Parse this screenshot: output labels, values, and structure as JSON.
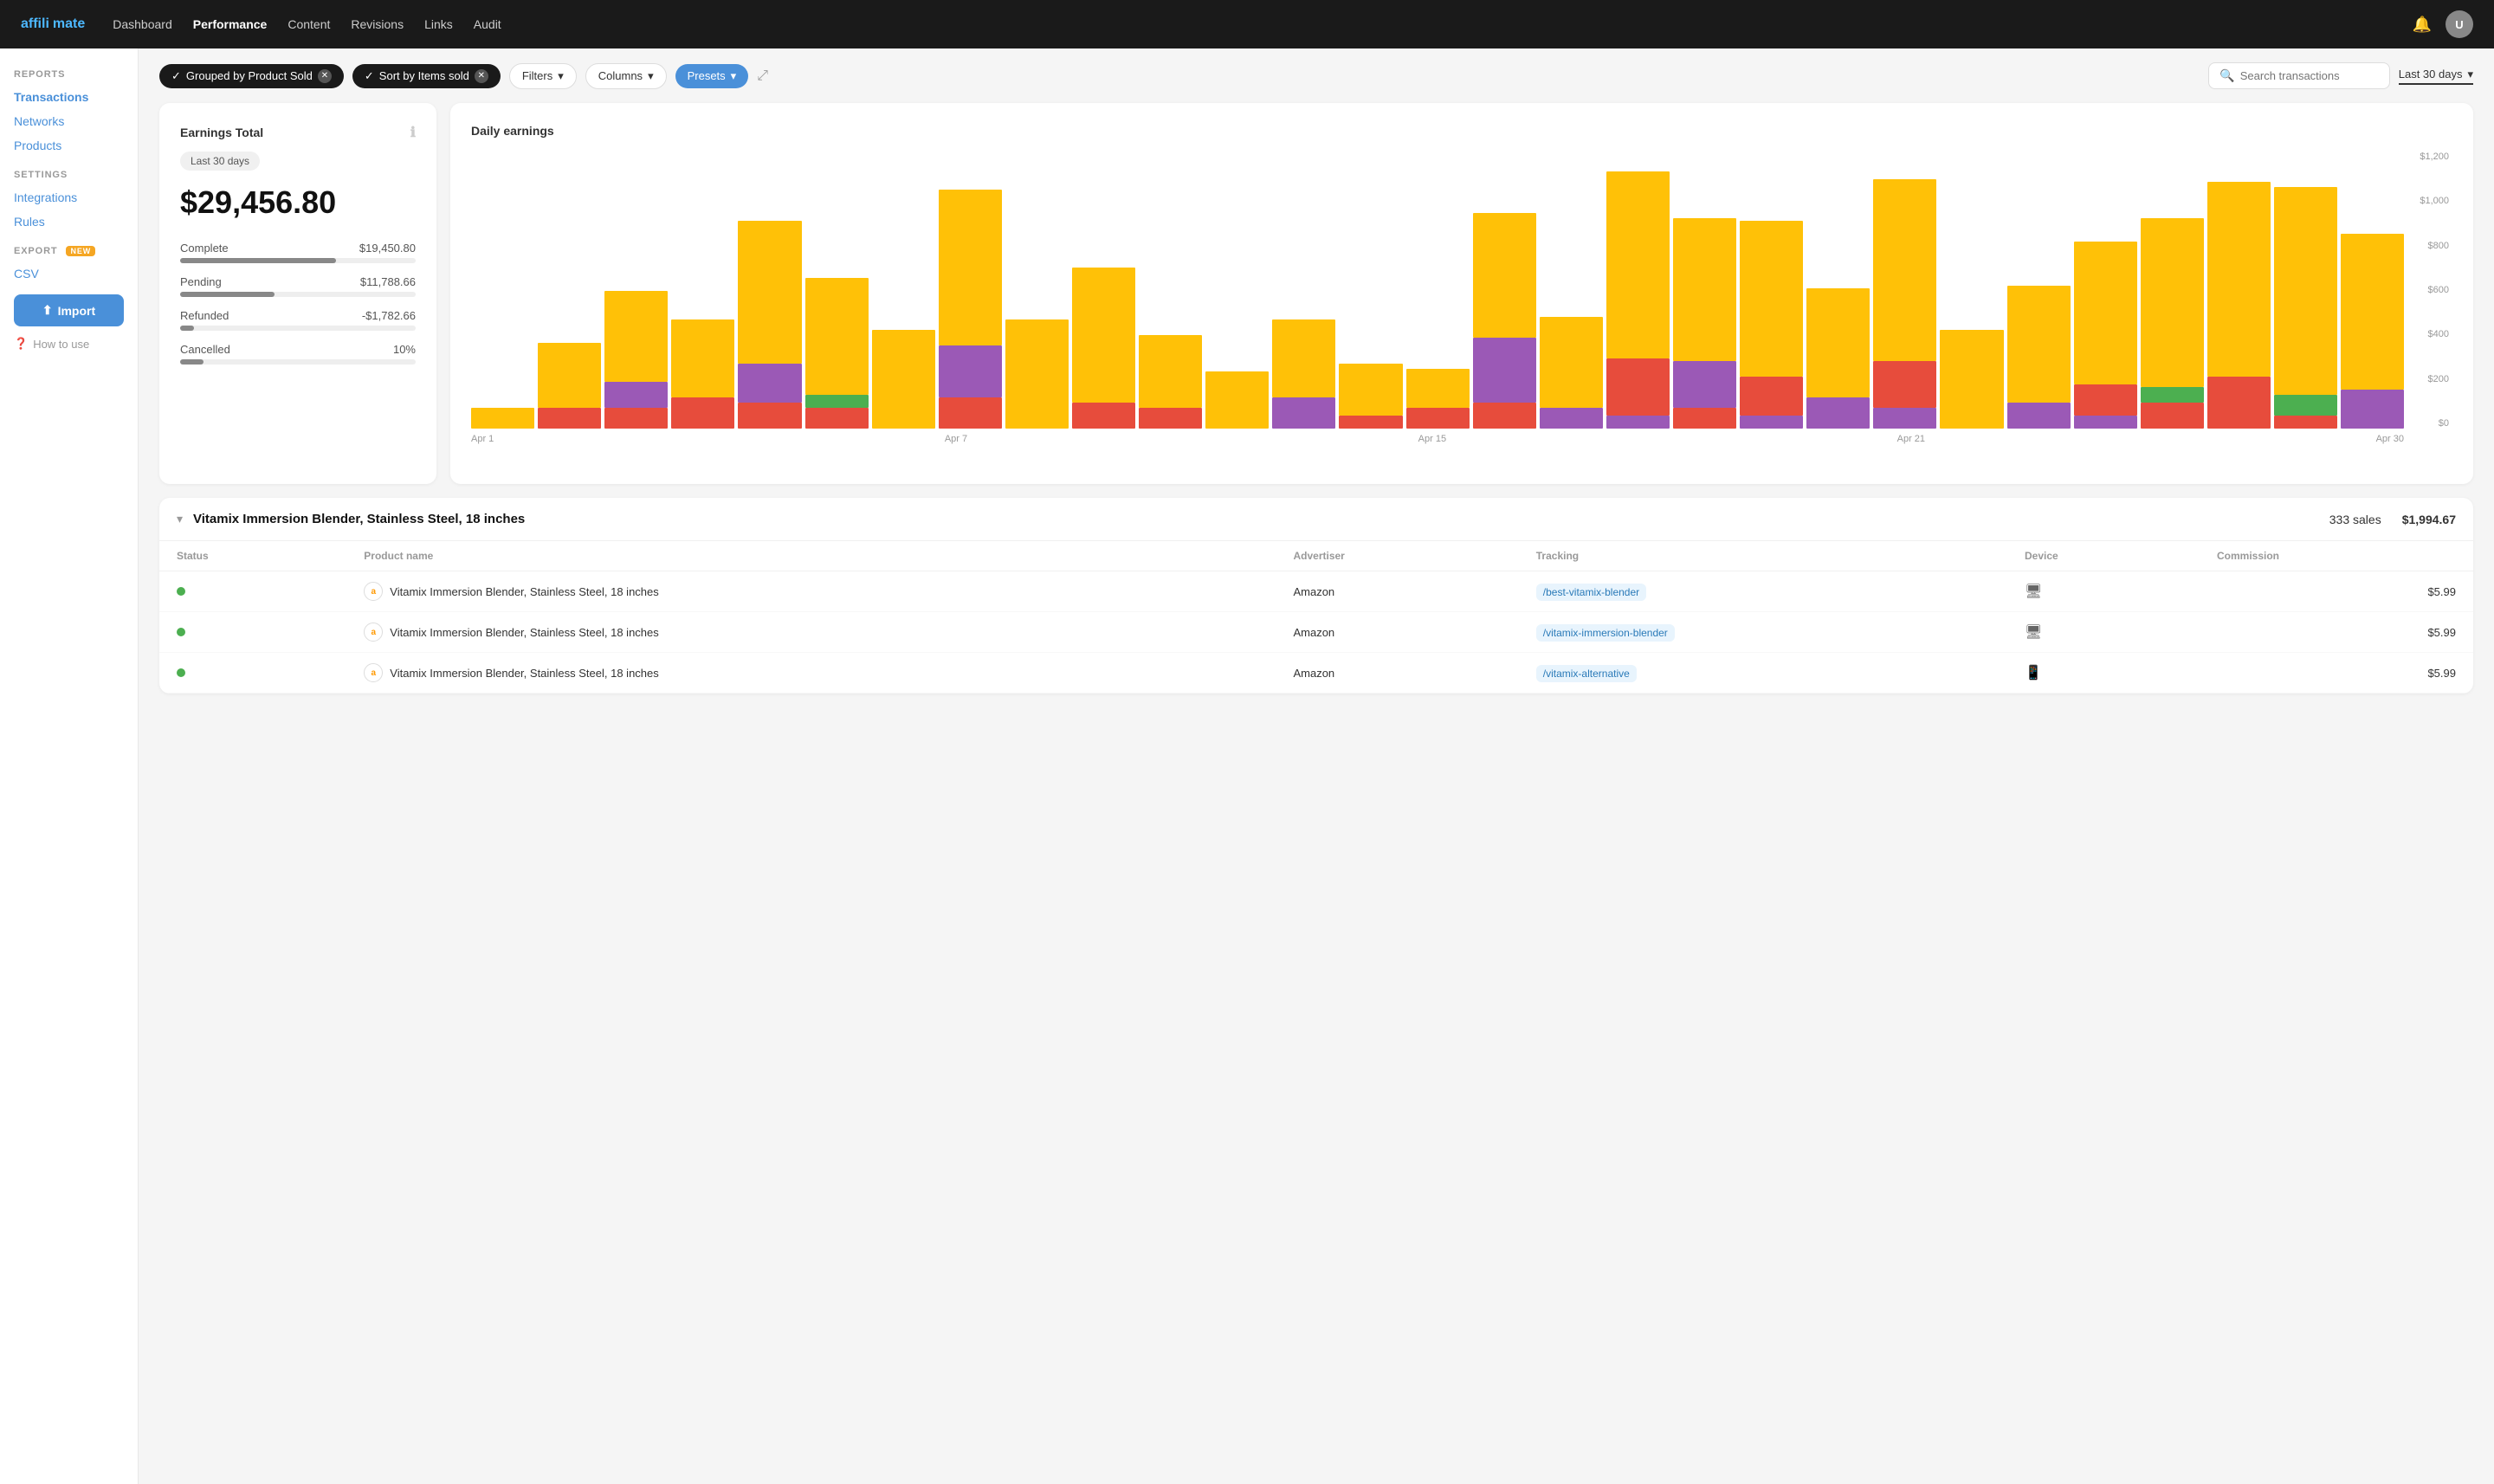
{
  "brand": {
    "name_part1": "affili",
    "name_part2": "mate"
  },
  "nav": {
    "links": [
      {
        "label": "Dashboard",
        "active": false
      },
      {
        "label": "Performance",
        "active": true
      },
      {
        "label": "Content",
        "active": false
      },
      {
        "label": "Revisions",
        "active": false
      },
      {
        "label": "Links",
        "active": false
      },
      {
        "label": "Audit",
        "active": false
      }
    ]
  },
  "sidebar": {
    "reports_label": "REPORTS",
    "reports_links": [
      {
        "label": "Transactions",
        "active": true
      },
      {
        "label": "Networks",
        "active": false
      },
      {
        "label": "Products",
        "active": false
      }
    ],
    "settings_label": "SETTINGS",
    "settings_links": [
      {
        "label": "Integrations",
        "active": false
      },
      {
        "label": "Rules",
        "active": false
      }
    ],
    "export_label": "EXPORT",
    "export_badge": "NEW",
    "export_links": [
      {
        "label": "CSV",
        "active": false
      }
    ],
    "import_label": "Import",
    "how_to_label": "How to use"
  },
  "toolbar": {
    "chip1_label": "Grouped by Product Sold",
    "chip2_label": "Sort by Items sold",
    "filters_label": "Filters",
    "columns_label": "Columns",
    "presets_label": "Presets",
    "search_placeholder": "Search transactions",
    "date_range_label": "Last 30 days"
  },
  "earnings": {
    "title": "Earnings Total",
    "period": "Last 30 days",
    "total": "$29,456.80",
    "metrics": [
      {
        "label": "Complete",
        "value": "$19,450.80",
        "pct": 66
      },
      {
        "label": "Pending",
        "value": "$11,788.66",
        "pct": 40
      },
      {
        "label": "Refunded",
        "value": "-$1,782.66",
        "pct": 6
      },
      {
        "label": "Cancelled",
        "value": "10%",
        "pct": 10
      }
    ]
  },
  "chart": {
    "title": "Daily earnings",
    "y_labels": [
      "$0",
      "$200",
      "$400",
      "$600",
      "$800",
      "$1,000",
      "$1,200"
    ],
    "x_labels": [
      "Apr 1",
      "Apr 7",
      "Apr 15",
      "Apr 21",
      "Apr 30"
    ],
    "bars": [
      {
        "segments": [
          {
            "color": "#FFC107",
            "h": 8
          }
        ]
      },
      {
        "segments": [
          {
            "color": "#FFC107",
            "h": 25
          },
          {
            "color": "#e74c3c",
            "h": 8
          }
        ]
      },
      {
        "segments": [
          {
            "color": "#FFC107",
            "h": 35
          },
          {
            "color": "#9b59b6",
            "h": 10
          },
          {
            "color": "#e74c3c",
            "h": 8
          }
        ]
      },
      {
        "segments": [
          {
            "color": "#FFC107",
            "h": 30
          },
          {
            "color": "#e74c3c",
            "h": 12
          }
        ]
      },
      {
        "segments": [
          {
            "color": "#FFC107",
            "h": 55
          },
          {
            "color": "#9b59b6",
            "h": 15
          },
          {
            "color": "#e74c3c",
            "h": 10
          }
        ]
      },
      {
        "segments": [
          {
            "color": "#FFC107",
            "h": 45
          },
          {
            "color": "#4caf50",
            "h": 5
          },
          {
            "color": "#e74c3c",
            "h": 8
          }
        ]
      },
      {
        "segments": [
          {
            "color": "#FFC107",
            "h": 38
          }
        ]
      },
      {
        "segments": [
          {
            "color": "#FFC107",
            "h": 60
          },
          {
            "color": "#9b59b6",
            "h": 20
          },
          {
            "color": "#e74c3c",
            "h": 12
          }
        ]
      },
      {
        "segments": [
          {
            "color": "#FFC107",
            "h": 42
          }
        ]
      },
      {
        "segments": [
          {
            "color": "#FFC107",
            "h": 52
          },
          {
            "color": "#e74c3c",
            "h": 10
          }
        ]
      },
      {
        "segments": [
          {
            "color": "#FFC107",
            "h": 28
          },
          {
            "color": "#e74c3c",
            "h": 8
          }
        ]
      },
      {
        "segments": [
          {
            "color": "#FFC107",
            "h": 22
          }
        ]
      },
      {
        "segments": [
          {
            "color": "#FFC107",
            "h": 30
          },
          {
            "color": "#9b59b6",
            "h": 12
          }
        ]
      },
      {
        "segments": [
          {
            "color": "#FFC107",
            "h": 20
          },
          {
            "color": "#e74c3c",
            "h": 5
          }
        ]
      },
      {
        "segments": [
          {
            "color": "#FFC107",
            "h": 15
          },
          {
            "color": "#e74c3c",
            "h": 8
          }
        ]
      },
      {
        "segments": [
          {
            "color": "#FFC107",
            "h": 48
          },
          {
            "color": "#9b59b6",
            "h": 25
          },
          {
            "color": "#e74c3c",
            "h": 10
          }
        ]
      },
      {
        "segments": [
          {
            "color": "#FFC107",
            "h": 35
          },
          {
            "color": "#9b59b6",
            "h": 8
          }
        ]
      },
      {
        "segments": [
          {
            "color": "#FFC107",
            "h": 72
          },
          {
            "color": "#e74c3c",
            "h": 22
          },
          {
            "color": "#9b59b6",
            "h": 5
          }
        ]
      },
      {
        "segments": [
          {
            "color": "#FFC107",
            "h": 55
          },
          {
            "color": "#9b59b6",
            "h": 18
          },
          {
            "color": "#e74c3c",
            "h": 8
          }
        ]
      },
      {
        "segments": [
          {
            "color": "#FFC107",
            "h": 60
          },
          {
            "color": "#e74c3c",
            "h": 15
          },
          {
            "color": "#9b59b6",
            "h": 5
          }
        ]
      },
      {
        "segments": [
          {
            "color": "#FFC107",
            "h": 42
          },
          {
            "color": "#9b59b6",
            "h": 12
          }
        ]
      },
      {
        "segments": [
          {
            "color": "#FFC107",
            "h": 70
          },
          {
            "color": "#e74c3c",
            "h": 18
          },
          {
            "color": "#9b59b6",
            "h": 8
          }
        ]
      },
      {
        "segments": [
          {
            "color": "#FFC107",
            "h": 38
          }
        ]
      },
      {
        "segments": [
          {
            "color": "#FFC107",
            "h": 45
          },
          {
            "color": "#9b59b6",
            "h": 10
          }
        ]
      },
      {
        "segments": [
          {
            "color": "#FFC107",
            "h": 55
          },
          {
            "color": "#e74c3c",
            "h": 12
          },
          {
            "color": "#9b59b6",
            "h": 5
          }
        ]
      },
      {
        "segments": [
          {
            "color": "#FFC107",
            "h": 65
          },
          {
            "color": "#4caf50",
            "h": 6
          },
          {
            "color": "#e74c3c",
            "h": 10
          }
        ]
      },
      {
        "segments": [
          {
            "color": "#FFC107",
            "h": 75
          },
          {
            "color": "#e74c3c",
            "h": 20
          }
        ]
      },
      {
        "segments": [
          {
            "color": "#FFC107",
            "h": 80
          },
          {
            "color": "#4caf50",
            "h": 8
          },
          {
            "color": "#e74c3c",
            "h": 5
          }
        ]
      },
      {
        "segments": [
          {
            "color": "#FFC107",
            "h": 60
          },
          {
            "color": "#9b59b6",
            "h": 15
          }
        ]
      }
    ]
  },
  "product_group": {
    "title": "Vitamix Immersion Blender, Stainless Steel, 18 inches",
    "sales": "333 sales",
    "commission": "$1,994.67",
    "table": {
      "columns": [
        "Status",
        "Product name",
        "Advertiser",
        "Tracking",
        "Device",
        "Commission"
      ],
      "rows": [
        {
          "status": "complete",
          "product": "Vitamix Immersion Blender, Stainless Steel, 18 inches",
          "advertiser": "Amazon",
          "tracking": "/best-vitamix-blender",
          "device": "desktop",
          "commission": "$5.99"
        },
        {
          "status": "complete",
          "product": "Vitamix Immersion Blender, Stainless Steel, 18 inches",
          "advertiser": "Amazon",
          "tracking": "/vitamix-immersion-blender",
          "device": "desktop",
          "commission": "$5.99"
        },
        {
          "status": "complete",
          "product": "Vitamix Immersion Blender, Stainless Steel, 18 inches",
          "advertiser": "Amazon",
          "tracking": "/vitamix-alternative",
          "device": "mobile",
          "commission": "$5.99"
        }
      ]
    }
  }
}
